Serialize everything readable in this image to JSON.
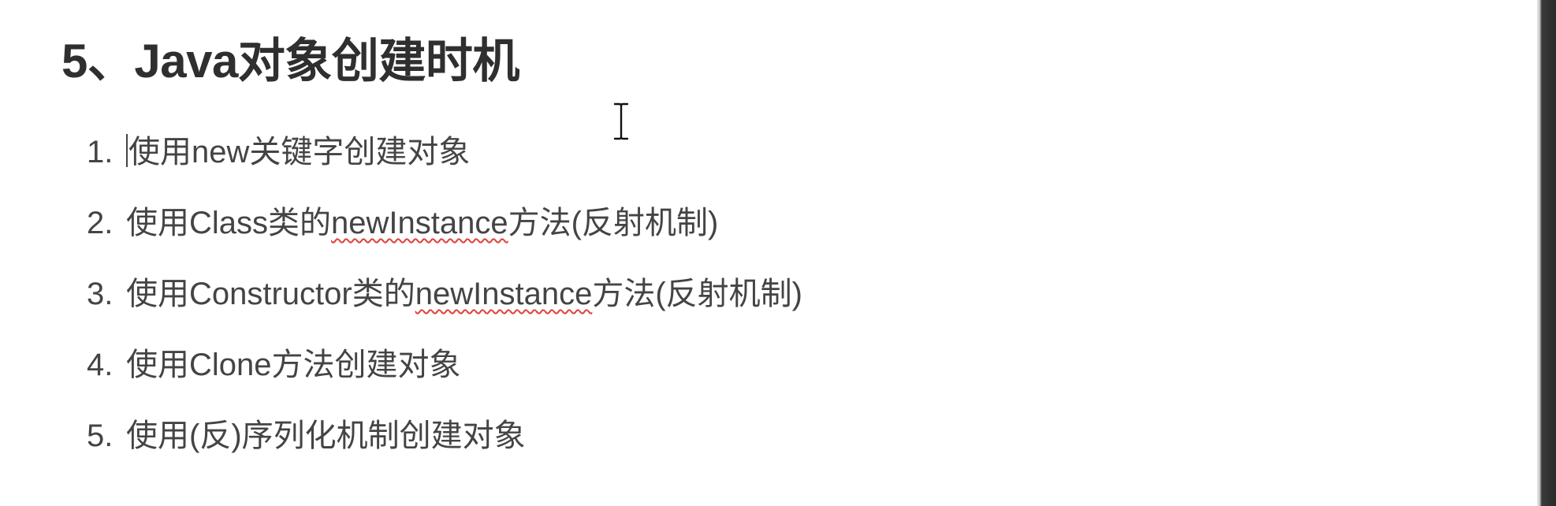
{
  "document": {
    "heading": "5、Java对象创建时机",
    "items": [
      {
        "number": "1.",
        "segments": [
          "使用new关键字创建对象"
        ]
      },
      {
        "number": "2.",
        "segments": [
          "使用Class类的",
          "newInstance",
          "方法(反射机制)"
        ]
      },
      {
        "number": "3.",
        "segments": [
          "使用Constructor类的",
          "newInstance",
          "方法(反射机制)"
        ]
      },
      {
        "number": "4.",
        "segments": [
          "使用Clone方法创建对象"
        ]
      },
      {
        "number": "5.",
        "segments": [
          "使用(反)序列化机制创建对象"
        ]
      }
    ]
  },
  "colors": {
    "heading": "#2f2f2f",
    "body_text": "#444444",
    "spellcheck_underline": "#e0403a",
    "background": "#ffffff"
  },
  "cursor": {
    "icon": "text-ibeam-cursor-icon"
  }
}
